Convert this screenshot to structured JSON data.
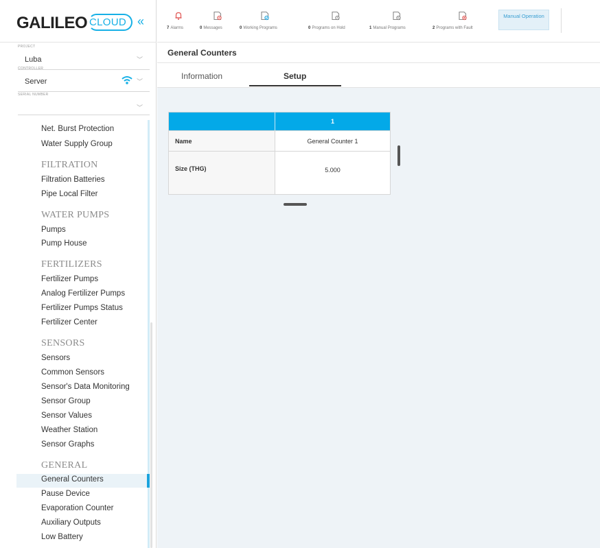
{
  "brand": {
    "name": "GALILEO",
    "product": "CLOUD"
  },
  "sidebar": {
    "project": {
      "label": "PROJECT",
      "value": "Luba"
    },
    "controller": {
      "label": "CONTROLLER",
      "value": "Server"
    },
    "serial": {
      "label": "SERIAL NUMBER",
      "value": ""
    },
    "menu": [
      {
        "type": "item",
        "label": "Net. Burst Protection"
      },
      {
        "type": "item",
        "label": "Water Supply Group"
      },
      {
        "type": "group",
        "label": "FILTRATION"
      },
      {
        "type": "item",
        "label": "Filtration Batteries"
      },
      {
        "type": "item",
        "label": "Pipe Local Filter"
      },
      {
        "type": "group",
        "label": "WATER PUMPS"
      },
      {
        "type": "item",
        "label": "Pumps"
      },
      {
        "type": "item",
        "label": "Pump House"
      },
      {
        "type": "group",
        "label": "FERTILIZERS"
      },
      {
        "type": "item",
        "label": "Fertilizer Pumps"
      },
      {
        "type": "item",
        "label": "Analog Fertilizer Pumps"
      },
      {
        "type": "item",
        "label": "Fertilizer Pumps Status"
      },
      {
        "type": "item",
        "label": "Fertilizer Center"
      },
      {
        "type": "group",
        "label": "SENSORS"
      },
      {
        "type": "item",
        "label": "Sensors"
      },
      {
        "type": "item",
        "label": "Common Sensors"
      },
      {
        "type": "item",
        "label": "Sensor's Data Monitoring"
      },
      {
        "type": "item",
        "label": "Sensor Group"
      },
      {
        "type": "item",
        "label": "Sensor Values"
      },
      {
        "type": "item",
        "label": "Weather Station"
      },
      {
        "type": "item",
        "label": "Sensor Graphs"
      },
      {
        "type": "group",
        "label": "GENERAL"
      },
      {
        "type": "item",
        "label": "General Counters",
        "active": true
      },
      {
        "type": "item",
        "label": "Pause Device"
      },
      {
        "type": "item",
        "label": "Evaporation Counter"
      },
      {
        "type": "item",
        "label": "Auxiliary Outputs"
      },
      {
        "type": "item",
        "label": "Low Battery"
      }
    ]
  },
  "topbar": {
    "stats": [
      {
        "count": "7",
        "label": "Alarms",
        "icon": "bell-icon",
        "color": "#e0524f"
      },
      {
        "count": "0",
        "label": "Messages",
        "icon": "message-icon",
        "color": "#e0524f"
      },
      {
        "count": "0",
        "label": "Working Programs",
        "icon": "program-working-icon",
        "color": "#1aa3dd"
      },
      {
        "count": "0",
        "label": "Programs on Hold",
        "icon": "program-hold-icon",
        "color": "#888888"
      },
      {
        "count": "1",
        "label": "Manual Programs",
        "icon": "program-manual-icon",
        "color": "#888888"
      },
      {
        "count": "2",
        "label": "Programs with Fault",
        "icon": "program-fault-icon",
        "color": "#e0524f"
      }
    ],
    "manual_operation": "Manual Operation"
  },
  "page": {
    "title": "General Counters",
    "tabs": [
      "Information",
      "Setup"
    ],
    "active_tab": "Setup"
  },
  "grid": {
    "columns": [
      "1"
    ],
    "rows": [
      {
        "label": "Name",
        "value": "General Counter 1"
      },
      {
        "label": "Size (THG)",
        "value": "5.000"
      }
    ]
  }
}
